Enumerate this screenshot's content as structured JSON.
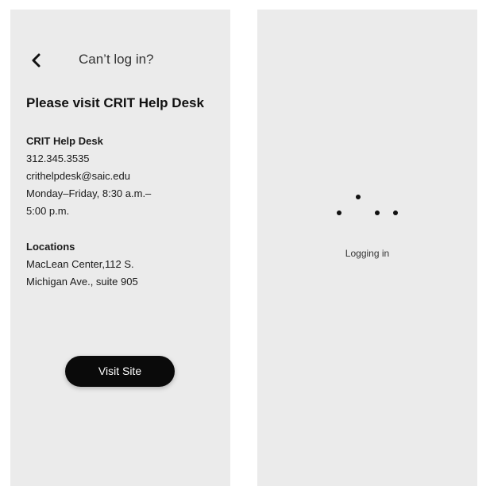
{
  "help_screen": {
    "header_title": "Can’t log in?",
    "heading": "Please visit CRIT Help Desk",
    "desk": {
      "title": "CRIT Help Desk",
      "phone": "312.345.3535",
      "email": "crithelpdesk@saic.edu",
      "hours_line1": "Monday–Friday, 8:30 a.m.–",
      "hours_line2": "5:00 p.m."
    },
    "locations": {
      "title": "Locations",
      "line1": "MacLean Center,112 S.",
      "line2": "Michigan Ave., suite 905"
    },
    "visit_button_label": "Visit Site"
  },
  "loading_screen": {
    "status_text": "Logging in"
  },
  "icons": {
    "back": "chevron-left-icon",
    "loader": "loading-dots-icon"
  },
  "colors": {
    "screen_background": "#ebebeb",
    "button_background": "#0a0a0a",
    "button_text": "#ffffff",
    "text_primary": "#111111"
  }
}
